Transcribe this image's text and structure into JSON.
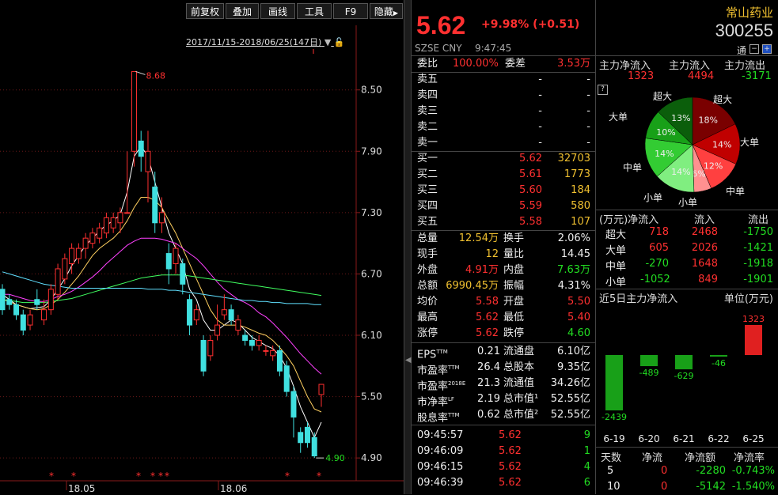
{
  "toolbar": {
    "buttons": [
      "前复权",
      "叠加",
      "画线",
      "工具",
      "F9",
      "隐藏"
    ],
    "range_label": "2017/11/15-2018/06/25(147日)"
  },
  "chart_data": {
    "type": "candlestick",
    "ylim": [
      4.7,
      8.9
    ],
    "price_ticks": [
      "8.50",
      "7.90",
      "7.30",
      "6.70",
      "6.10",
      "5.50",
      "4.90"
    ],
    "x_labels": [
      "18.05",
      "18.06"
    ],
    "high_label": "8.68",
    "low_label": "4.90",
    "candles": [
      {
        "o": 6.55,
        "c": 6.35,
        "h": 6.6,
        "l": 6.3
      },
      {
        "o": 6.45,
        "c": 6.4,
        "h": 6.5,
        "l": 6.35
      },
      {
        "o": 6.4,
        "c": 6.3,
        "h": 6.45,
        "l": 6.25
      },
      {
        "o": 6.3,
        "c": 6.15,
        "h": 6.35,
        "l": 6.1
      },
      {
        "o": 6.2,
        "c": 6.3,
        "h": 6.35,
        "l": 6.15
      },
      {
        "o": 6.45,
        "c": 6.4,
        "h": 6.55,
        "l": 6.35
      },
      {
        "o": 6.25,
        "c": 6.35,
        "h": 6.45,
        "l": 6.2
      },
      {
        "o": 6.35,
        "c": 6.55,
        "h": 6.6,
        "l": 6.3
      },
      {
        "o": 6.5,
        "c": 6.75,
        "h": 6.8,
        "l": 6.45
      },
      {
        "o": 6.65,
        "c": 6.85,
        "h": 6.9,
        "l": 6.6
      },
      {
        "o": 6.8,
        "c": 6.95,
        "h": 7.0,
        "l": 6.7
      },
      {
        "o": 6.85,
        "c": 6.95,
        "h": 7.0,
        "l": 6.8
      },
      {
        "o": 6.95,
        "c": 7.05,
        "h": 7.1,
        "l": 6.85
      },
      {
        "o": 7.0,
        "c": 7.1,
        "h": 7.15,
        "l": 6.95
      },
      {
        "o": 7.05,
        "c": 7.15,
        "h": 7.2,
        "l": 7.0
      },
      {
        "o": 7.1,
        "c": 7.25,
        "h": 7.3,
        "l": 7.05
      },
      {
        "o": 7.15,
        "c": 7.25,
        "h": 7.3,
        "l": 7.1
      },
      {
        "o": 7.2,
        "c": 7.3,
        "h": 7.35,
        "l": 7.1
      },
      {
        "o": 7.3,
        "c": 7.3,
        "h": 7.9,
        "l": 7.3
      },
      {
        "o": 7.9,
        "c": 8.68,
        "h": 8.68,
        "l": 7.75
      },
      {
        "o": 8.0,
        "c": 7.85,
        "h": 8.1,
        "l": 7.7
      },
      {
        "o": 7.7,
        "c": 7.9,
        "h": 8.1,
        "l": 7.4
      },
      {
        "o": 7.55,
        "c": 7.2,
        "h": 7.7,
        "l": 7.1
      },
      {
        "o": 7.2,
        "c": 7.3,
        "h": 7.45,
        "l": 7.1
      },
      {
        "o": 6.9,
        "c": 6.75,
        "h": 7.0,
        "l": 6.6
      },
      {
        "o": 6.8,
        "c": 6.95,
        "h": 7.0,
        "l": 6.7
      },
      {
        "o": 6.8,
        "c": 6.6,
        "h": 6.85,
        "l": 6.5
      },
      {
        "o": 6.45,
        "c": 6.2,
        "h": 6.5,
        "l": 6.1
      },
      {
        "o": 6.25,
        "c": 6.35,
        "h": 6.4,
        "l": 6.2
      },
      {
        "o": 6.05,
        "c": 5.75,
        "h": 6.1,
        "l": 5.7
      },
      {
        "o": 5.9,
        "c": 6.05,
        "h": 6.1,
        "l": 5.85
      },
      {
        "o": 6.1,
        "c": 6.2,
        "h": 6.4,
        "l": 6.05
      },
      {
        "o": 6.3,
        "c": 6.35,
        "h": 6.5,
        "l": 6.25
      },
      {
        "o": 6.35,
        "c": 6.25,
        "h": 6.4,
        "l": 6.2
      },
      {
        "o": 6.15,
        "c": 6.25,
        "h": 6.3,
        "l": 6.1
      },
      {
        "o": 6.1,
        "c": 6.05,
        "h": 6.15,
        "l": 6.0
      },
      {
        "o": 6.05,
        "c": 6.0,
        "h": 6.1,
        "l": 5.95
      },
      {
        "o": 6.0,
        "c": 6.05,
        "h": 6.1,
        "l": 5.95
      },
      {
        "o": 5.95,
        "c": 5.95,
        "h": 6.0,
        "l": 5.9
      },
      {
        "o": 5.9,
        "c": 5.95,
        "h": 6.0,
        "l": 5.85
      },
      {
        "o": 5.95,
        "c": 5.75,
        "h": 6.0,
        "l": 5.7
      },
      {
        "o": 5.8,
        "c": 5.55,
        "h": 5.85,
        "l": 5.5
      },
      {
        "o": 5.55,
        "c": 5.3,
        "h": 5.6,
        "l": 5.1
      },
      {
        "o": 5.15,
        "c": 5.05,
        "h": 5.2,
        "l": 4.95
      },
      {
        "o": 5.2,
        "c": 5.05,
        "h": 5.25,
        "l": 5.0
      },
      {
        "o": 5.1,
        "c": 4.92,
        "h": 5.15,
        "l": 4.9
      },
      {
        "o": 5.52,
        "c": 5.62,
        "h": 5.62,
        "l": 5.4
      }
    ],
    "ma_series": [
      {
        "color": "#ffffff",
        "values": [
          6.5,
          6.45,
          6.4,
          6.38,
          6.36,
          6.37,
          6.38,
          6.45,
          6.55,
          6.65,
          6.78,
          6.88,
          6.98,
          7.05,
          7.12,
          7.18,
          7.22,
          7.28,
          7.5,
          7.85,
          7.95,
          7.85,
          7.6,
          7.35,
          7.1,
          6.95,
          6.8,
          6.55,
          6.45,
          6.25,
          6.15,
          6.15,
          6.2,
          6.25,
          6.22,
          6.15,
          6.08,
          6.04,
          6.0,
          5.97,
          5.9,
          5.78,
          5.6,
          5.4,
          5.25,
          5.1,
          5.25
        ]
      },
      {
        "color": "#ffd060",
        "values": [
          6.45,
          6.43,
          6.4,
          6.38,
          6.36,
          6.35,
          6.36,
          6.4,
          6.45,
          6.52,
          6.6,
          6.68,
          6.78,
          6.88,
          6.95,
          7.0,
          7.05,
          7.12,
          7.22,
          7.35,
          7.45,
          7.45,
          7.42,
          7.35,
          7.22,
          7.1,
          6.95,
          6.8,
          6.65,
          6.5,
          6.35,
          6.25,
          6.2,
          6.2,
          6.2,
          6.18,
          6.15,
          6.12,
          6.1,
          6.05,
          5.98,
          5.9,
          5.8,
          5.65,
          5.5,
          5.38,
          5.35
        ]
      },
      {
        "color": "#ff40ff",
        "values": [
          6.5,
          6.5,
          6.48,
          6.46,
          6.44,
          6.43,
          6.43,
          6.45,
          6.48,
          6.5,
          6.53,
          6.57,
          6.62,
          6.67,
          6.73,
          6.8,
          6.86,
          6.92,
          6.98,
          7.02,
          7.05,
          7.05,
          7.05,
          7.04,
          7.02,
          7.0,
          6.95,
          6.9,
          6.85,
          6.78,
          6.7,
          6.62,
          6.55,
          6.5,
          6.45,
          6.42,
          6.38,
          6.32,
          6.28,
          6.22,
          6.15,
          6.08,
          6.0,
          5.92,
          5.85,
          5.78,
          5.72
        ]
      },
      {
        "color": "#40ff60",
        "values": [
          6.45,
          6.44,
          6.43,
          6.42,
          6.42,
          6.42,
          6.42,
          6.43,
          6.44,
          6.45,
          6.46,
          6.48,
          6.5,
          6.52,
          6.54,
          6.56,
          6.58,
          6.6,
          6.62,
          6.64,
          6.66,
          6.67,
          6.68,
          6.69,
          6.69,
          6.69,
          6.69,
          6.68,
          6.67,
          6.66,
          6.65,
          6.64,
          6.63,
          6.62,
          6.61,
          6.6,
          6.59,
          6.58,
          6.57,
          6.56,
          6.55,
          6.54,
          6.53,
          6.52,
          6.51,
          6.5,
          6.49
        ]
      },
      {
        "color": "#60e0ff",
        "values": [
          6.72,
          6.7,
          6.68,
          6.66,
          6.64,
          6.62,
          6.6,
          6.59,
          6.58,
          6.57,
          6.56,
          6.56,
          6.56,
          6.56,
          6.56,
          6.56,
          6.56,
          6.56,
          6.56,
          6.56,
          6.56,
          6.55,
          6.55,
          6.55,
          6.54,
          6.54,
          6.53,
          6.52,
          6.51,
          6.5,
          6.49,
          6.48,
          6.47,
          6.46,
          6.45,
          6.44,
          6.44,
          6.43,
          6.43,
          6.42,
          6.42,
          6.41,
          6.41,
          6.41,
          6.41,
          6.4,
          6.4
        ]
      }
    ],
    "star_markers": [
      15,
      22,
      48,
      55,
      62,
      69,
      100,
      110
    ],
    "star_char": "*"
  },
  "quote": {
    "price": "5.62",
    "change": "+9.98% (+0.51)",
    "exchange": "SZSE  CNY",
    "time": "9:47:45",
    "weibi_label": "委比",
    "weibi_val": "100.00%",
    "weicha_label": "委差",
    "weicha_val": "3.53万",
    "asks": [
      {
        "label": "卖五",
        "price": "-",
        "vol": "-"
      },
      {
        "label": "卖四",
        "price": "-",
        "vol": "-"
      },
      {
        "label": "卖三",
        "price": "-",
        "vol": "-"
      },
      {
        "label": "卖二",
        "price": "-",
        "vol": "-"
      },
      {
        "label": "卖一",
        "price": "-",
        "vol": "-"
      }
    ],
    "bids": [
      {
        "label": "买一",
        "price": "5.62",
        "vol": "32703"
      },
      {
        "label": "买二",
        "price": "5.61",
        "vol": "1773"
      },
      {
        "label": "买三",
        "price": "5.60",
        "vol": "184"
      },
      {
        "label": "买四",
        "price": "5.59",
        "vol": "580"
      },
      {
        "label": "买五",
        "price": "5.58",
        "vol": "107"
      }
    ],
    "stats": [
      {
        "l1": "总量",
        "v1": "12.54万",
        "l2": "换手",
        "v2": "2.06%",
        "c1": "yellow",
        "c2": "white"
      },
      {
        "l1": "现手",
        "v1": "12",
        "l2": "量比",
        "v2": "14.45",
        "c1": "yellow",
        "c2": "white"
      },
      {
        "l1": "外盘",
        "v1": "4.91万",
        "l2": "内盘",
        "v2": "7.63万",
        "c1": "red",
        "c2": "green"
      },
      {
        "l1": "总额",
        "v1": "6990.45万",
        "l2": "振幅",
        "v2": "4.31%",
        "c1": "yellow",
        "c2": "white"
      },
      {
        "l1": "均价",
        "v1": "5.58",
        "l2": "开盘",
        "v2": "5.50",
        "c1": "red",
        "c2": "red"
      },
      {
        "l1": "最高",
        "v1": "5.62",
        "l2": "最低",
        "v2": "5.40",
        "c1": "red",
        "c2": "red"
      },
      {
        "l1": "涨停",
        "v1": "5.62",
        "l2": "跌停",
        "v2": "4.60",
        "c1": "red",
        "c2": "green"
      }
    ],
    "fin": [
      {
        "l1": "EPS",
        "s1": "TTM",
        "v1": "0.21",
        "l2": "流通盘",
        "v2": "6.10亿"
      },
      {
        "l1": "市盈率",
        "s1": "TTM",
        "v1": "26.4",
        "l2": "总股本",
        "v2": "9.35亿"
      },
      {
        "l1": "市盈率",
        "s1": "2018E",
        "v1": "21.3",
        "l2": "流通值",
        "v2": "34.26亿"
      },
      {
        "l1": "市净率",
        "s1": "LF",
        "v1": "2.19",
        "l2": "总市值¹",
        "v2": "52.55亿"
      },
      {
        "l1": "股息率",
        "s1": "TTM",
        "v1": "0.62",
        "l2": "总市值²",
        "v2": "52.55亿"
      }
    ],
    "ticks": [
      {
        "time": "09:45:57",
        "price": "5.62",
        "vol": "9"
      },
      {
        "time": "09:46:09",
        "price": "5.62",
        "vol": "1"
      },
      {
        "time": "09:46:15",
        "price": "5.62",
        "vol": "4"
      },
      {
        "time": "09:46:39",
        "price": "5.62",
        "vol": "6"
      }
    ]
  },
  "right": {
    "name": "常山药业",
    "code": "300255",
    "flow_headers": [
      "主力净流入",
      "主力流入",
      "主力流出"
    ],
    "flow_values": [
      "1323",
      "4494",
      "-3171"
    ],
    "help_icon": "?",
    "tong_label": "通",
    "pie": {
      "slices": [
        {
          "label": "超大",
          "pct": "18%",
          "value": 18,
          "color": "#7a0000"
        },
        {
          "label": "大单",
          "pct": "14%",
          "value": 14,
          "color": "#c00000"
        },
        {
          "label": "中单",
          "pct": "12%",
          "value": 12,
          "color": "#ff4040"
        },
        {
          "label": "小单",
          "pct": "6%",
          "value": 6,
          "color": "#ff9090"
        },
        {
          "label": "小单",
          "pct": "14%",
          "value": 14,
          "color": "#80ee80"
        },
        {
          "label": "中单",
          "pct": "14%",
          "value": 14,
          "color": "#33cc33"
        },
        {
          "label": "大单",
          "pct": "10%",
          "value": 10,
          "color": "#18a018"
        },
        {
          "label": "超大",
          "pct": "13%",
          "value": 13,
          "color": "#0b5e0b"
        }
      ]
    },
    "flow_table_headers": [
      "(万元)净流入",
      "流入",
      "流出"
    ],
    "flow_table": [
      {
        "type": "超大",
        "net": "718",
        "in": "2468",
        "out": "-1750",
        "netc": "red"
      },
      {
        "type": "大单",
        "net": "605",
        "in": "2026",
        "out": "-1421",
        "netc": "red"
      },
      {
        "type": "中单",
        "net": "-270",
        "in": "1648",
        "out": "-1918",
        "netc": "green"
      },
      {
        "type": "小单",
        "net": "-1052",
        "in": "849",
        "out": "-1901",
        "netc": "green"
      }
    ],
    "bar_title": "近5日主力净流入",
    "bar_unit": "单位(万元)",
    "bars": [
      {
        "date": "6-19",
        "value": -2439
      },
      {
        "date": "6-20",
        "value": -489
      },
      {
        "date": "6-21",
        "value": -629
      },
      {
        "date": "6-22",
        "value": -46
      },
      {
        "date": "6-25",
        "value": 1323
      }
    ],
    "summary_headers": [
      "天数",
      "净流",
      "净流额",
      "净流率"
    ],
    "summary_rows": [
      {
        "days": "5",
        "flow": "0",
        "amt": "-2280",
        "rate": "-0.743%"
      },
      {
        "days": "10",
        "flow": "0",
        "amt": "-5142",
        "rate": "-1.540%"
      }
    ]
  }
}
